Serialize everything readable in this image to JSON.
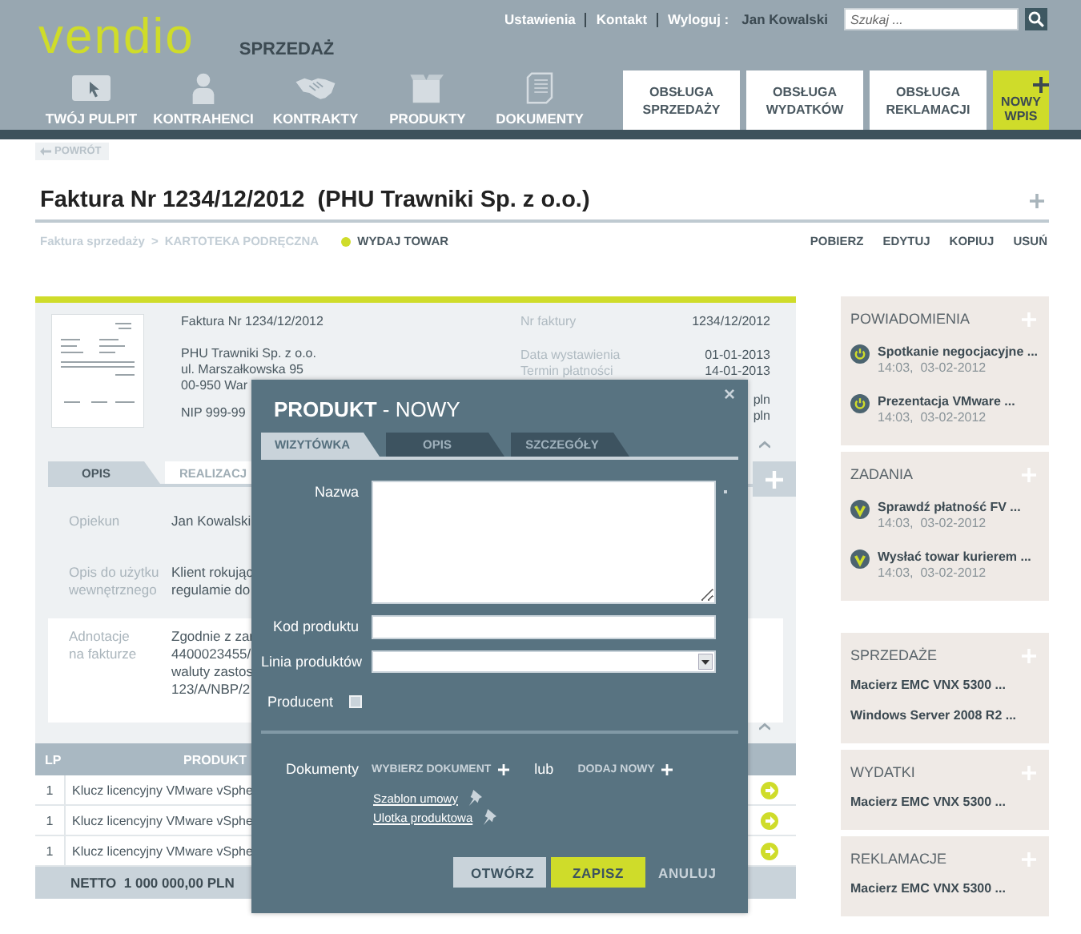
{
  "header": {
    "logo": "vendio",
    "module": "SPRZEDAŻ",
    "links": [
      "Ustawienia",
      "Kontakt",
      "Wyloguj :"
    ],
    "user": "Jan Kowalski",
    "search": {
      "placeholder": "Szukaj ..."
    }
  },
  "nav": [
    {
      "label": "TWÓJ PULPIT",
      "kind": "desktop"
    },
    {
      "label": "KONTRAHENCI",
      "kind": "person"
    },
    {
      "label": "KONTRAKTY",
      "kind": "handshake"
    },
    {
      "label": "PRODUKTY",
      "kind": "box"
    },
    {
      "label": "DOKUMENTY",
      "kind": "document"
    }
  ],
  "quick_actions": [
    {
      "label": "OBSŁUGA SPRZEDAŻY",
      "kind": "plain"
    },
    {
      "label": "OBSŁUGA WYDATKÓW",
      "kind": "plain"
    },
    {
      "label": "OBSŁUGA REKLAMACJI",
      "kind": "plain"
    },
    {
      "label": "NOWY WPIS",
      "kind": "new"
    }
  ],
  "back_button": "POWRÓT",
  "title": "Faktura Nr 1234/12/2012  (PHU Trawniki Sp. z o.o.)",
  "breadcrumb": {
    "items": [
      "Faktura sprzedaży",
      "KARTOTEKA PODRĘCZNA"
    ],
    "separator": ">"
  },
  "status": "WYDAJ TOWAR",
  "actions": [
    "POBIERZ",
    "EDYTUJ",
    "KOPIUJ",
    "USUŃ"
  ],
  "summary": {
    "left": [
      [
        "Faktura Nr 1234/12/2012"
      ],
      [
        "PHU Trawniki Sp. z o.o.",
        "ul. Marszałkowska 95",
        "00-950 War"
      ],
      [
        "NIP 999-99"
      ]
    ],
    "fields": [
      {
        "label": "Nr faktury",
        "value": "1234/12/2012"
      },
      {
        "label": "Data wystawienia",
        "value": "01-01-2013"
      },
      {
        "label": "Termin płatności",
        "value": "14-01-2013"
      }
    ],
    "amounts": [
      "pln",
      "pln"
    ]
  },
  "tabs": [
    {
      "label": "OPIS",
      "selected": true
    },
    {
      "label": "REALIZACJ",
      "selected": false
    }
  ],
  "details": [
    {
      "label": [
        "Opiekun"
      ],
      "value": [
        "Jan Kowalski"
      ],
      "highlighted": false
    },
    {
      "label": [
        "Opis do użytku",
        "wewnętrznego"
      ],
      "value": [
        "Klient rokując",
        "regulamie do"
      ],
      "highlighted": false
    },
    {
      "label": [
        "Adnotacje",
        "na fakturze"
      ],
      "value": [
        "Zgodnie z zar",
        "4400023455/",
        "waluty zastos",
        "123/A/NBP/2"
      ],
      "highlighted": true
    }
  ],
  "table": {
    "columns": [
      "LP",
      "PRODUKT"
    ],
    "rows": [
      {
        "cells": [
          "1",
          "Klucz licencyjny VMware vSphe"
        ]
      },
      {
        "cells": [
          "1",
          "Klucz licencyjny VMware vSphe"
        ]
      },
      {
        "cells": [
          "1",
          "Klucz licencyjny VMware vSphe"
        ]
      }
    ],
    "total": "NETTO  1 000 000,00 PLN"
  },
  "modal": {
    "title": "**PRODUKT** - NOWY",
    "close": "×",
    "tabs": [
      {
        "label": "WIZYTÓWKA",
        "selected": true
      },
      {
        "label": "OPIS",
        "selected": false
      },
      {
        "label": "SZCZEGÓŁY",
        "selected": false
      }
    ],
    "fields": [
      {
        "kind": "textarea",
        "label": "Nazwa",
        "required": true
      },
      {
        "kind": "text",
        "label": "Kod produktu"
      },
      {
        "kind": "select",
        "label": "Linia produktów"
      },
      {
        "kind": "checkbox",
        "label": "Producent",
        "checked": false
      }
    ],
    "documents": {
      "label": "Dokumenty",
      "choose": "WYBIERZ DOKUMENT",
      "or": "lub",
      "add": "DODAJ NOWY",
      "files": [
        "Szablon umowy",
        "Ulotka produktowa"
      ]
    },
    "buttons": [
      {
        "label": "OTWÓRZ",
        "kind": "secondary"
      },
      {
        "label": "ZAPISZ",
        "kind": "primary"
      },
      {
        "label": "ANULUJ",
        "kind": "link"
      }
    ]
  },
  "sidebar": {
    "groups": [
      [
        {
          "title": "POWIADOMIENIA",
          "items": [
            {
              "kind": "notification",
              "title": "Spotkanie negocjacyjne ...",
              "time": "14:03,  03-02-2012"
            },
            {
              "kind": "notification",
              "title": "Prezentacja VMware ...",
              "time": "14:03,  03-02-2012"
            }
          ]
        },
        {
          "title": "ZADANIA",
          "items": [
            {
              "kind": "task",
              "title": "Sprawdź płatność FV ...",
              "time": "14:03,  03-02-2012"
            },
            {
              "kind": "task",
              "title": "Wysłać towar kurierem ...",
              "time": "14:03,  03-02-2012"
            }
          ]
        }
      ],
      [
        {
          "title": "SPRZEDAŻE",
          "items": [
            {
              "kind": "plain",
              "title": "Macierz EMC VNX 5300 ..."
            },
            {
              "kind": "plain",
              "title": "Windows Server 2008 R2 ..."
            }
          ]
        },
        {
          "title": "WYDATKI",
          "items": [
            {
              "kind": "plain",
              "title": "Macierz EMC VNX 5300 ..."
            }
          ]
        },
        {
          "title": "REKLAMACJE",
          "items": [
            {
              "kind": "plain",
              "title": "Macierz EMC VNX 5300 ..."
            }
          ]
        }
      ]
    ]
  }
}
